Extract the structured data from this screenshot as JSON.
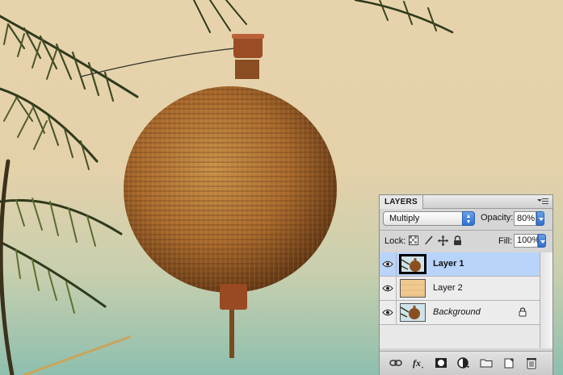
{
  "canvas": {
    "subject": "woven-wicker-lantern-photo"
  },
  "layers_panel": {
    "tab_label": "LAYERS",
    "blend_mode": "Multiply",
    "opacity_label": "Opacity:",
    "opacity_value": "80%",
    "lock_label": "Lock:",
    "fill_label": "Fill:",
    "fill_value": "100%",
    "layers": [
      {
        "name": "Layer 1",
        "visible": true,
        "selected": true,
        "thumbnail": "lantern-photo"
      },
      {
        "name": "Layer 2",
        "visible": true,
        "selected": false,
        "thumbnail": "paper-texture"
      },
      {
        "name": "Background",
        "visible": true,
        "selected": false,
        "thumbnail": "lantern-photo",
        "locked": true
      }
    ],
    "bottom_icons": [
      "link-icon",
      "fx-icon",
      "layer-mask-icon",
      "adjustment-layer-icon",
      "group-folder-icon",
      "new-layer-icon",
      "trash-icon"
    ],
    "lock_icons": [
      "lock-transparent-pixels-icon",
      "lock-image-pixels-icon",
      "lock-position-icon",
      "lock-all-icon"
    ],
    "colors": {
      "selected_row": "#b9d4fb",
      "accent_blue": "#2f6fd0"
    }
  }
}
